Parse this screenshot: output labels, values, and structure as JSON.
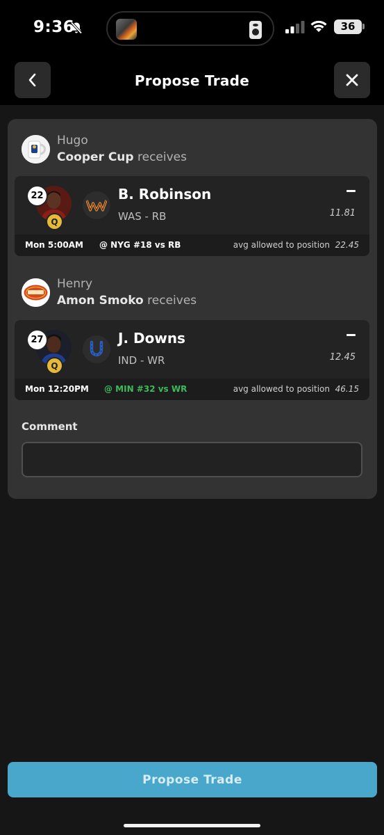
{
  "status_bar": {
    "time": "9:36",
    "battery": "36",
    "icons": [
      "bell-slash-icon",
      "signal-icon",
      "wifi-icon",
      "battery-icon"
    ]
  },
  "header": {
    "title": "Propose Trade",
    "back_icon": "chevron-left-icon",
    "close_icon": "close-icon"
  },
  "trade": {
    "parties": [
      {
        "owner": "Hugo",
        "team": "Cooper Cup",
        "receives_label": "receives",
        "player": {
          "rank": "22",
          "status": "Q",
          "name": "B. Robinson",
          "position": "WAS - RB",
          "projection": "11.81",
          "game_time": "Mon 5:00AM",
          "matchup": "@ NYG #18 vs RB",
          "matchup_color": "#ffffff",
          "avg_label": "avg allowed to position",
          "avg_value": "22.45",
          "team_logo": "commanders-logo-icon"
        }
      },
      {
        "owner": "Henry",
        "team": "Amon Smoko",
        "receives_label": "receives",
        "player": {
          "rank": "27",
          "status": "Q",
          "name": "J. Downs",
          "position": "IND - WR",
          "projection": "12.45",
          "game_time": "Mon 12:20PM",
          "matchup": "@ MIN #32 vs WR",
          "matchup_color": "#3dba5a",
          "avg_label": "avg allowed to position",
          "avg_value": "46.15",
          "team_logo": "colts-horseshoe-icon"
        }
      }
    ]
  },
  "comment": {
    "label": "Comment",
    "value": "",
    "placeholder": ""
  },
  "footer": {
    "button_label": "Propose Trade"
  },
  "colors": {
    "accent": "#49a7cc",
    "background": "#161616",
    "card": "#333333",
    "good_matchup": "#3dba5a",
    "questionable": "#e5b93a"
  }
}
